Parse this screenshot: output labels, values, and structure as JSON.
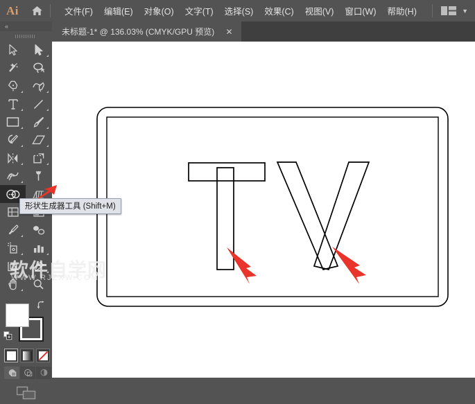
{
  "app": {
    "name": "Adobe Illustrator",
    "logo_text": "Ai",
    "logo_color": "#d99d6a",
    "home_icon": "home-icon",
    "workspace_icon": "workspace-switcher-icon",
    "workspace_chevron": "chevron-down-icon",
    "bg_chrome": "#535353",
    "bg_tabstrip": "#3f3f3f",
    "canvas_bg": "#ffffff",
    "accent_red": "#e8342a"
  },
  "menubar": {
    "items": [
      {
        "label": "文件(F)",
        "name": "menu-file"
      },
      {
        "label": "编辑(E)",
        "name": "menu-edit"
      },
      {
        "label": "对象(O)",
        "name": "menu-object"
      },
      {
        "label": "文字(T)",
        "name": "menu-type"
      },
      {
        "label": "选择(S)",
        "name": "menu-select"
      },
      {
        "label": "效果(C)",
        "name": "menu-effect"
      },
      {
        "label": "视图(V)",
        "name": "menu-view"
      },
      {
        "label": "窗口(W)",
        "name": "menu-window"
      },
      {
        "label": "帮助(H)",
        "name": "menu-help"
      }
    ]
  },
  "tabs": [
    {
      "title": "未标题-1* @ 136.03% (CMYK/GPU 预览)",
      "doc_name": "未标题-1",
      "modified": true,
      "zoom": "136.03%",
      "color_mode": "CMYK",
      "render_mode": "GPU 预览",
      "close_label": "✕",
      "active": true
    }
  ],
  "toolbar": {
    "collapse_label": "«",
    "rows": [
      [
        {
          "name": "selection-tool",
          "icon": "arrow-cursor-icon",
          "flyout": false,
          "selected": false
        },
        {
          "name": "direct-selection-tool",
          "icon": "filled-arrow-cursor-icon",
          "flyout": true,
          "selected": false
        }
      ],
      [
        {
          "name": "magic-wand-tool",
          "icon": "magic-wand-icon",
          "flyout": false,
          "selected": false
        },
        {
          "name": "lasso-tool",
          "icon": "lasso-icon",
          "flyout": false,
          "selected": false
        }
      ],
      [
        {
          "name": "pen-tool",
          "icon": "pen-nib-icon",
          "flyout": true,
          "selected": false
        },
        {
          "name": "curvature-tool",
          "icon": "curvature-pen-icon",
          "flyout": true,
          "selected": false
        }
      ],
      [
        {
          "name": "type-tool",
          "icon": "type-T-icon",
          "flyout": true,
          "selected": false
        },
        {
          "name": "line-segment-tool",
          "icon": "diagonal-line-icon",
          "flyout": true,
          "selected": false
        }
      ],
      [
        {
          "name": "rectangle-tool",
          "icon": "rectangle-icon",
          "flyout": true,
          "selected": false
        },
        {
          "name": "paintbrush-tool",
          "icon": "paintbrush-icon",
          "flyout": true,
          "selected": false
        }
      ],
      [
        {
          "name": "shaper-tool",
          "icon": "shaper-pencil-icon",
          "flyout": true,
          "selected": false
        },
        {
          "name": "eraser-tool",
          "icon": "eraser-icon",
          "flyout": true,
          "selected": false
        }
      ],
      [
        {
          "name": "rotate-tool",
          "icon": "reflect-rotate-icon",
          "flyout": true,
          "selected": false
        },
        {
          "name": "scale-tool",
          "icon": "scale-shear-icon",
          "flyout": true,
          "selected": false
        }
      ],
      [
        {
          "name": "width-tool",
          "icon": "width-warp-icon",
          "flyout": true,
          "selected": false
        },
        {
          "name": "free-transform-tool",
          "icon": "free-transform-pin-icon",
          "flyout": false,
          "selected": false
        }
      ],
      [
        {
          "name": "shape-builder-tool",
          "icon": "shape-builder-icon",
          "flyout": true,
          "selected": true
        },
        {
          "name": "perspective-grid-tool",
          "icon": "perspective-grid-icon",
          "flyout": true,
          "selected": false
        }
      ],
      [
        {
          "name": "mesh-tool",
          "icon": "mesh-grid-icon",
          "flyout": false,
          "selected": false
        },
        {
          "name": "gradient-tool",
          "icon": "gradient-bar-icon",
          "flyout": false,
          "selected": false
        }
      ],
      [
        {
          "name": "eyedropper-tool",
          "icon": "eyedropper-icon",
          "flyout": true,
          "selected": false
        },
        {
          "name": "blend-tool",
          "icon": "blend-icon",
          "flyout": false,
          "selected": false
        }
      ],
      [
        {
          "name": "symbol-sprayer-tool",
          "icon": "symbol-sprayer-icon",
          "flyout": true,
          "selected": false
        },
        {
          "name": "column-graph-tool",
          "icon": "bar-chart-icon",
          "flyout": true,
          "selected": false
        }
      ],
      [
        {
          "name": "artboard-tool",
          "icon": "artboard-icon",
          "flyout": false,
          "selected": false
        },
        {
          "name": "slice-tool",
          "icon": "slice-icon",
          "flyout": true,
          "selected": false
        }
      ],
      [
        {
          "name": "hand-tool",
          "icon": "hand-icon",
          "flyout": true,
          "selected": false
        },
        {
          "name": "zoom-tool",
          "icon": "magnifier-icon",
          "flyout": false,
          "selected": false
        }
      ]
    ],
    "tooltip": {
      "text": "形状生成器工具 (Shift+M)",
      "tool_name": "形状生成器工具",
      "shortcut": "Shift+M",
      "visible": true
    },
    "color_controls": {
      "fill_label": "填色",
      "fill_color": "#ffffff",
      "stroke_label": "描边",
      "stroke_color": "#000000",
      "swap_icon": "swap-fill-stroke-icon",
      "default_icon": "default-fill-stroke-icon",
      "modes": [
        {
          "name": "color-mode-flat",
          "icon": "flat-color-icon",
          "active": true
        },
        {
          "name": "color-mode-gradient",
          "icon": "gradient-icon",
          "active": false
        },
        {
          "name": "color-mode-none",
          "icon": "none-slash-icon",
          "active": false
        }
      ],
      "draw_modes": [
        {
          "name": "draw-normal-mode",
          "icon": "draw-normal-icon",
          "active": true
        },
        {
          "name": "draw-behind-mode",
          "icon": "draw-behind-icon",
          "active": false
        },
        {
          "name": "draw-inside-mode",
          "icon": "draw-inside-icon",
          "active": false
        }
      ],
      "screen_mode": {
        "name": "change-screen-mode",
        "icon": "screen-mode-icon"
      }
    }
  },
  "canvas": {
    "zoom_level": "136.03%",
    "artboard": {
      "name": "artboard-frame",
      "shape": "rounded-rectangle",
      "stroke_color": "#000000"
    },
    "artwork": {
      "description": "Letterform outlines spelling TV built from overlapping open paths",
      "letters": [
        {
          "glyph": "T",
          "name": "letter-T-outline",
          "parts": [
            {
              "name": "T-crossbar-rectangle",
              "shape": "rectangle"
            },
            {
              "name": "T-stem-rectangle",
              "shape": "rectangle"
            }
          ]
        },
        {
          "glyph": "V",
          "name": "letter-V-outline",
          "parts": [
            {
              "name": "V-left-stroke",
              "shape": "slanted-bar"
            },
            {
              "name": "V-right-stroke",
              "shape": "slanted-bar"
            }
          ]
        }
      ],
      "stroke_color": "#000000",
      "fill_color": "#ffffff"
    },
    "annotations": [
      {
        "name": "annotation-arrow-on-T",
        "color": "#e8342a",
        "points_to": "T-stem-overlap"
      },
      {
        "name": "annotation-arrow-on-V",
        "color": "#e8342a",
        "points_to": "V-right-stroke-overlap"
      },
      {
        "name": "annotation-arrow-to-shape-builder",
        "color": "#e8342a",
        "points_to": "shape-builder-tool"
      }
    ]
  },
  "watermark": {
    "cn": "软件自学网",
    "en": "WWW.RJZXW.COM"
  }
}
